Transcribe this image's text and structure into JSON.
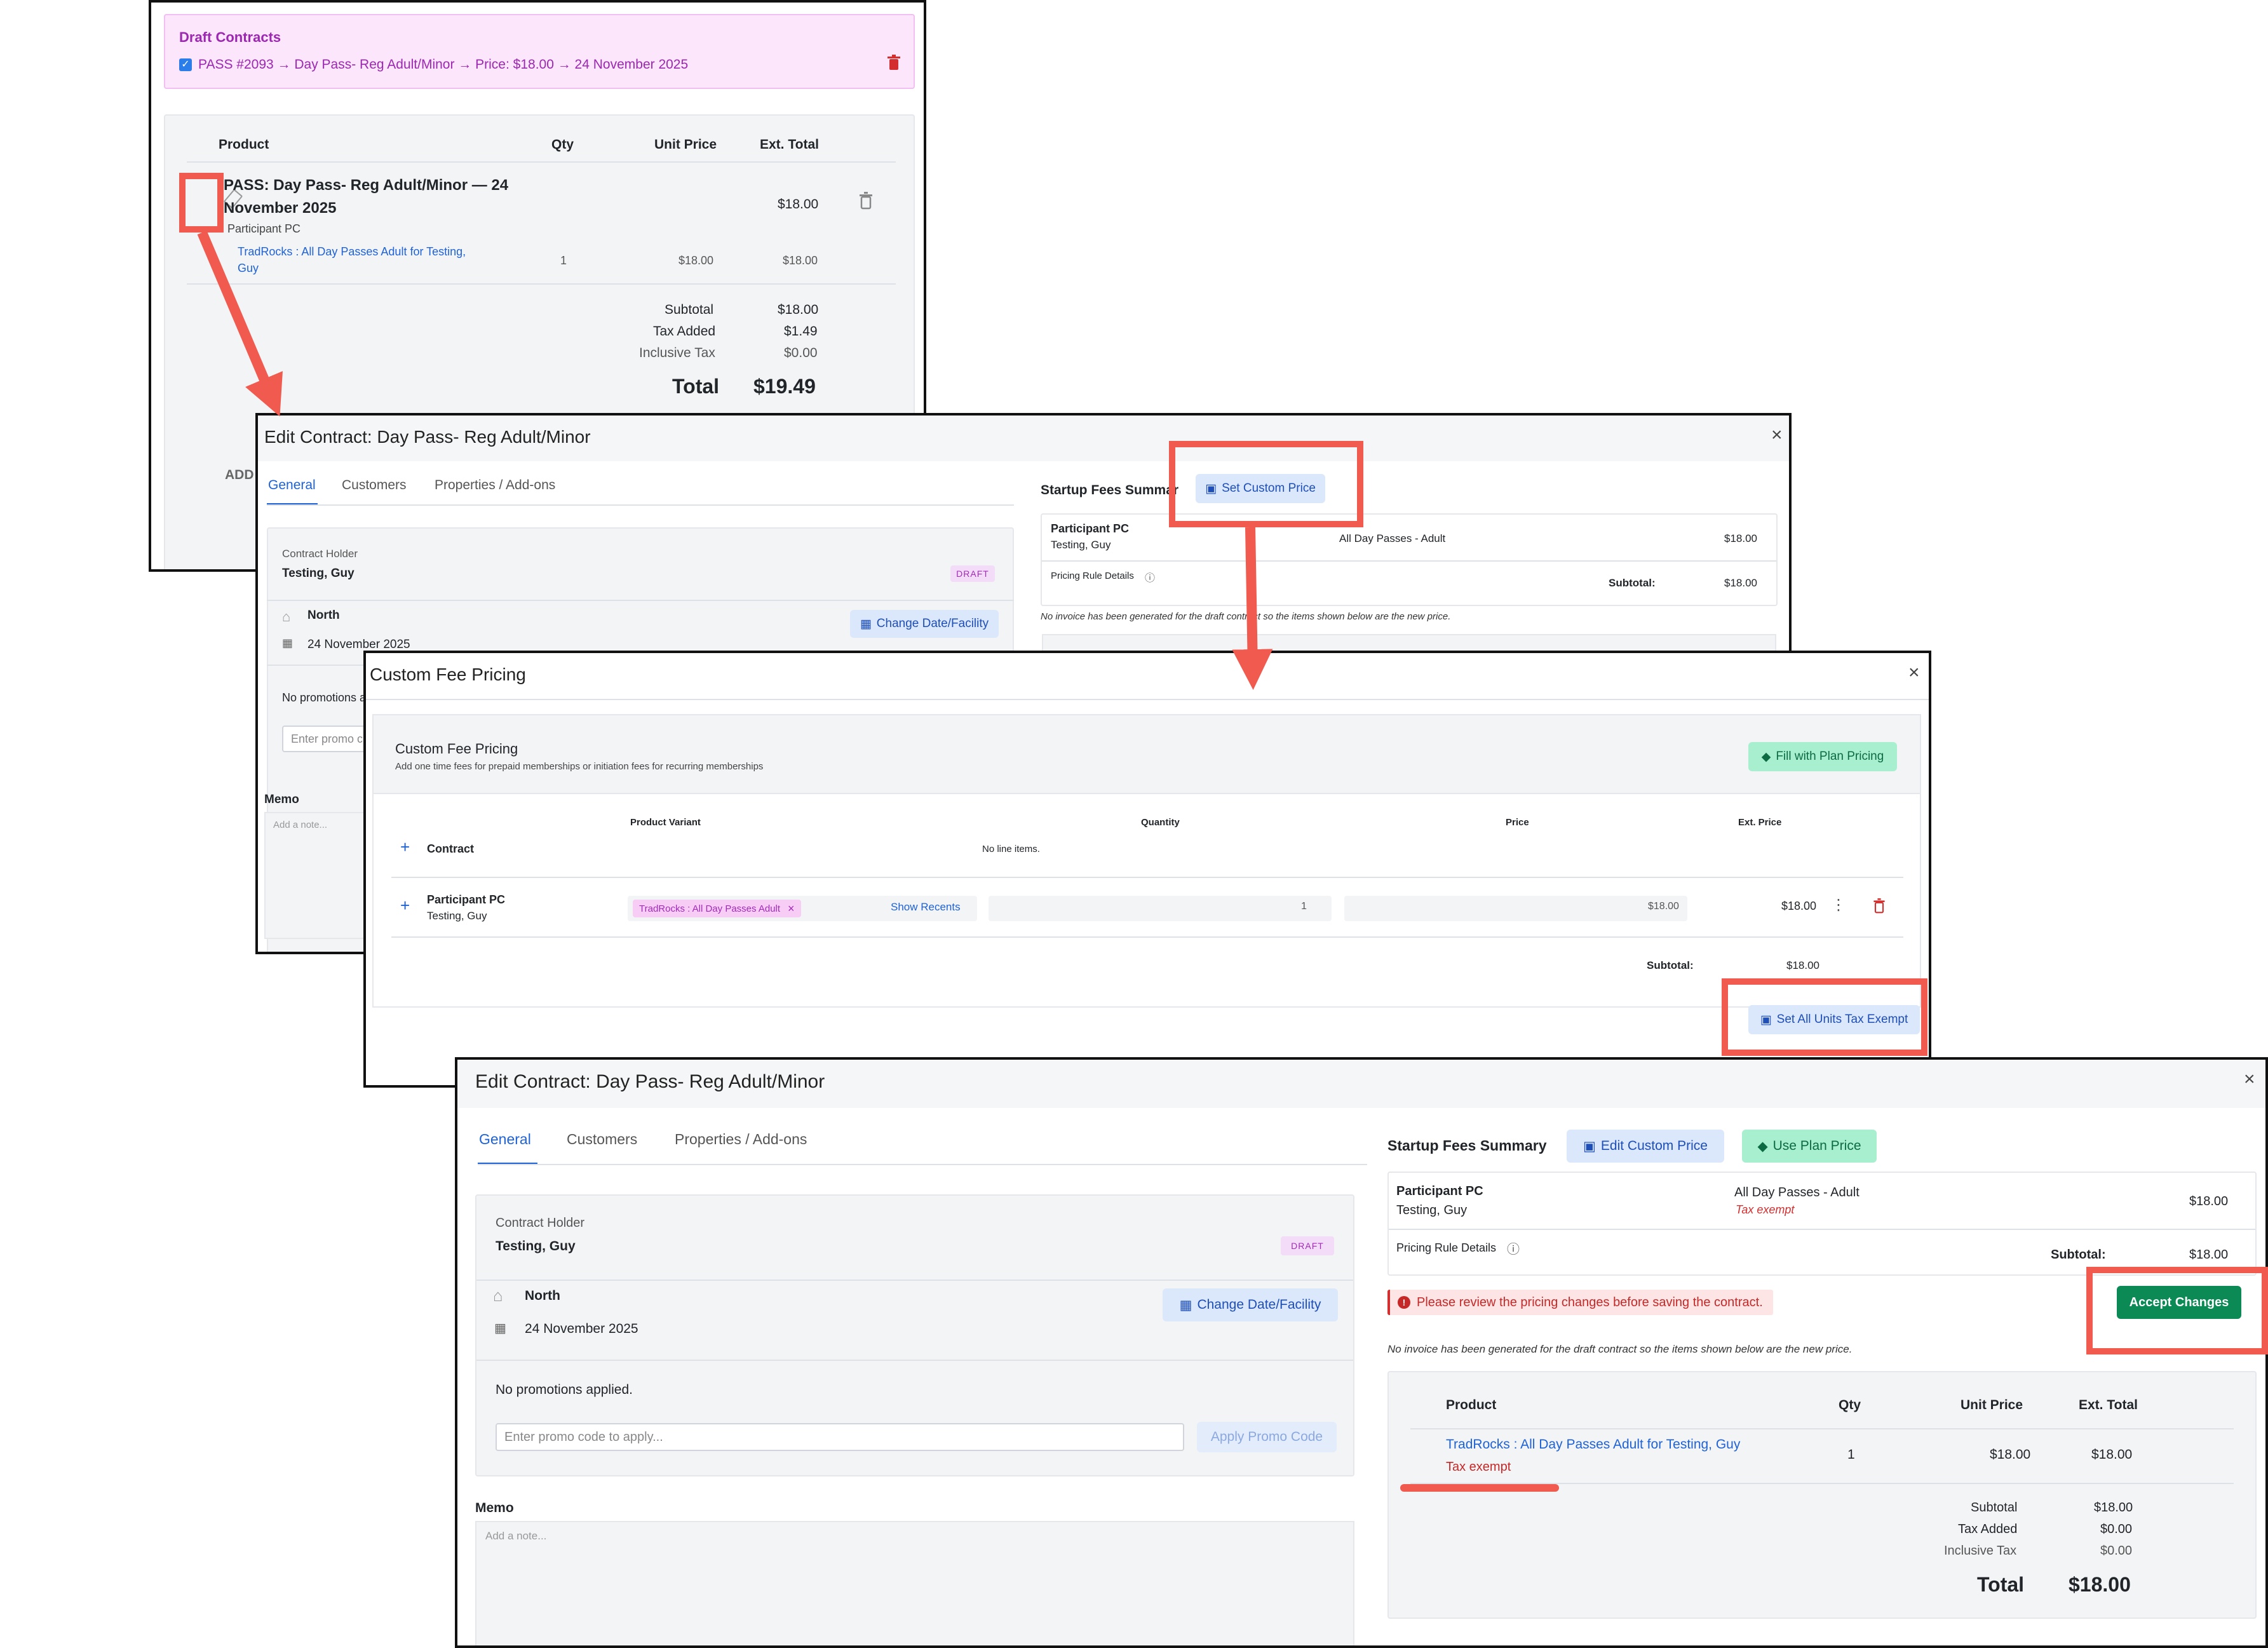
{
  "panel1": {
    "draft_title": "Draft Contracts",
    "draft_item": "PASS #2093 → Day Pass- Reg Adult/Minor → Price: $18.00 → 24 November 2025",
    "cols": {
      "product": "Product",
      "qty": "Qty",
      "unit_price": "Unit Price",
      "ext_total": "Ext. Total"
    },
    "product_title_line1": "PASS: Day Pass- Reg Adult/Minor — 24",
    "product_title_line2": "November 2025",
    "product_participant": "Participant PC",
    "product_ext": "$18.00",
    "line_link_1": "TradRocks : All Day Passes Adult for Testing,",
    "line_link_2": "Guy",
    "line_qty": "1",
    "line_unit": "$18.00",
    "line_ext": "$18.00",
    "subtotal_label": "Subtotal",
    "subtotal": "$18.00",
    "tax_label": "Tax Added",
    "tax": "$1.49",
    "incl_label": "Inclusive Tax",
    "incl": "$0.00",
    "total_label": "Total",
    "total": "$19.49",
    "add_label": "ADD"
  },
  "panel2": {
    "title": "Edit Contract: Day Pass- Reg Adult/Minor",
    "tabs": [
      "General",
      "Customers",
      "Properties / Add-ons"
    ],
    "holder_label": "Contract Holder",
    "holder_name": "Testing, Guy",
    "badge": "DRAFT",
    "facility": "North",
    "date": "24 November 2025",
    "change_btn": "Change Date/Facility",
    "promo_text": "No promotions a",
    "promo_placeholder": "Enter promo c",
    "memo_label": "Memo",
    "memo_placeholder": "Add a note...",
    "startup_label": "Startup Fees Summar",
    "set_custom_btn": "Set Custom Price",
    "participant": "Participant PC",
    "participant_name": "Testing, Guy",
    "pass_name": "All Day Passes - Adult",
    "amount": "$18.00",
    "pricing_rule": "Pricing Rule Details",
    "subtotal_label": "Subtotal:",
    "subtotal": "$18.00",
    "note": "No invoice has been generated for the draft contract so the items shown below are the new price."
  },
  "panel3": {
    "title": "Custom Fee Pricing",
    "header_title": "Custom Fee Pricing",
    "header_sub": "Add one time fees for prepaid memberships or initiation fees for recurring memberships",
    "fill_btn": "Fill with Plan Pricing",
    "cols": {
      "variant": "Product Variant",
      "qty": "Quantity",
      "price": "Price",
      "ext": "Ext. Price"
    },
    "contract_label": "Contract",
    "no_lines": "No line items.",
    "participant": "Participant PC",
    "participant_name": "Testing, Guy",
    "variant_tag": "TradRocks : All Day Passes Adult",
    "show_recents": "Show Recents",
    "qty": "1",
    "price": "$18.00",
    "ext": "$18.00",
    "subtotal_label": "Subtotal:",
    "subtotal": "$18.00",
    "tax_exempt_btn": "Set All Units Tax Exempt"
  },
  "panel4": {
    "title": "Edit Contract: Day Pass- Reg Adult/Minor",
    "tabs": [
      "General",
      "Customers",
      "Properties / Add-ons"
    ],
    "holder_label": "Contract Holder",
    "holder_name": "Testing, Guy",
    "badge": "DRAFT",
    "facility": "North",
    "date": "24 November 2025",
    "change_btn": "Change Date/Facility",
    "promo_text": "No promotions applied.",
    "promo_placeholder": "Enter promo code to apply...",
    "apply_btn": "Apply Promo Code",
    "memo_label": "Memo",
    "memo_placeholder": "Add a note...",
    "startup_label": "Startup Fees Summary",
    "edit_custom_btn": "Edit Custom Price",
    "use_plan_btn": "Use Plan Price",
    "participant": "Participant PC",
    "participant_name": "Testing, Guy",
    "pass_name": "All Day Passes - Adult",
    "tax_exempt": "Tax exempt",
    "amount": "$18.00",
    "pricing_rule": "Pricing Rule Details",
    "subtotal_label": "Subtotal:",
    "subtotal": "$18.00",
    "alert": "Please review the pricing changes before saving the contract.",
    "accept_btn": "Accept Changes",
    "note": "No invoice has been generated for the draft contract so the items shown below are the new price.",
    "cols": {
      "product": "Product",
      "qty": "Qty",
      "unit_price": "Unit Price",
      "ext_total": "Ext. Total"
    },
    "line_link": "TradRocks : All Day Passes Adult for Testing, Guy",
    "line_tax_exempt": "Tax exempt",
    "line_qty": "1",
    "line_unit": "$18.00",
    "line_ext": "$18.00",
    "sub_label": "Subtotal",
    "sub": "$18.00",
    "tax_label": "Tax Added",
    "tax": "$0.00",
    "incl_label": "Inclusive Tax",
    "incl": "$0.00",
    "total_label": "Total",
    "total": "$18.00"
  },
  "icons": {
    "close": "close-icon",
    "trash": "trash-icon",
    "pencil": "pencil-icon",
    "home": "home-icon",
    "calendar": "calendar-icon",
    "plus": "plus-icon",
    "kebab": "kebab-menu-icon",
    "cube": "cube-icon",
    "alert": "alert-circle-icon",
    "help": "help-circle-icon"
  },
  "colors": {
    "primary": "#1e62d6",
    "success": "#0b8a55",
    "danger": "#d32f2f",
    "purple": "#9c27b0",
    "highlight": "#f05a4f"
  }
}
